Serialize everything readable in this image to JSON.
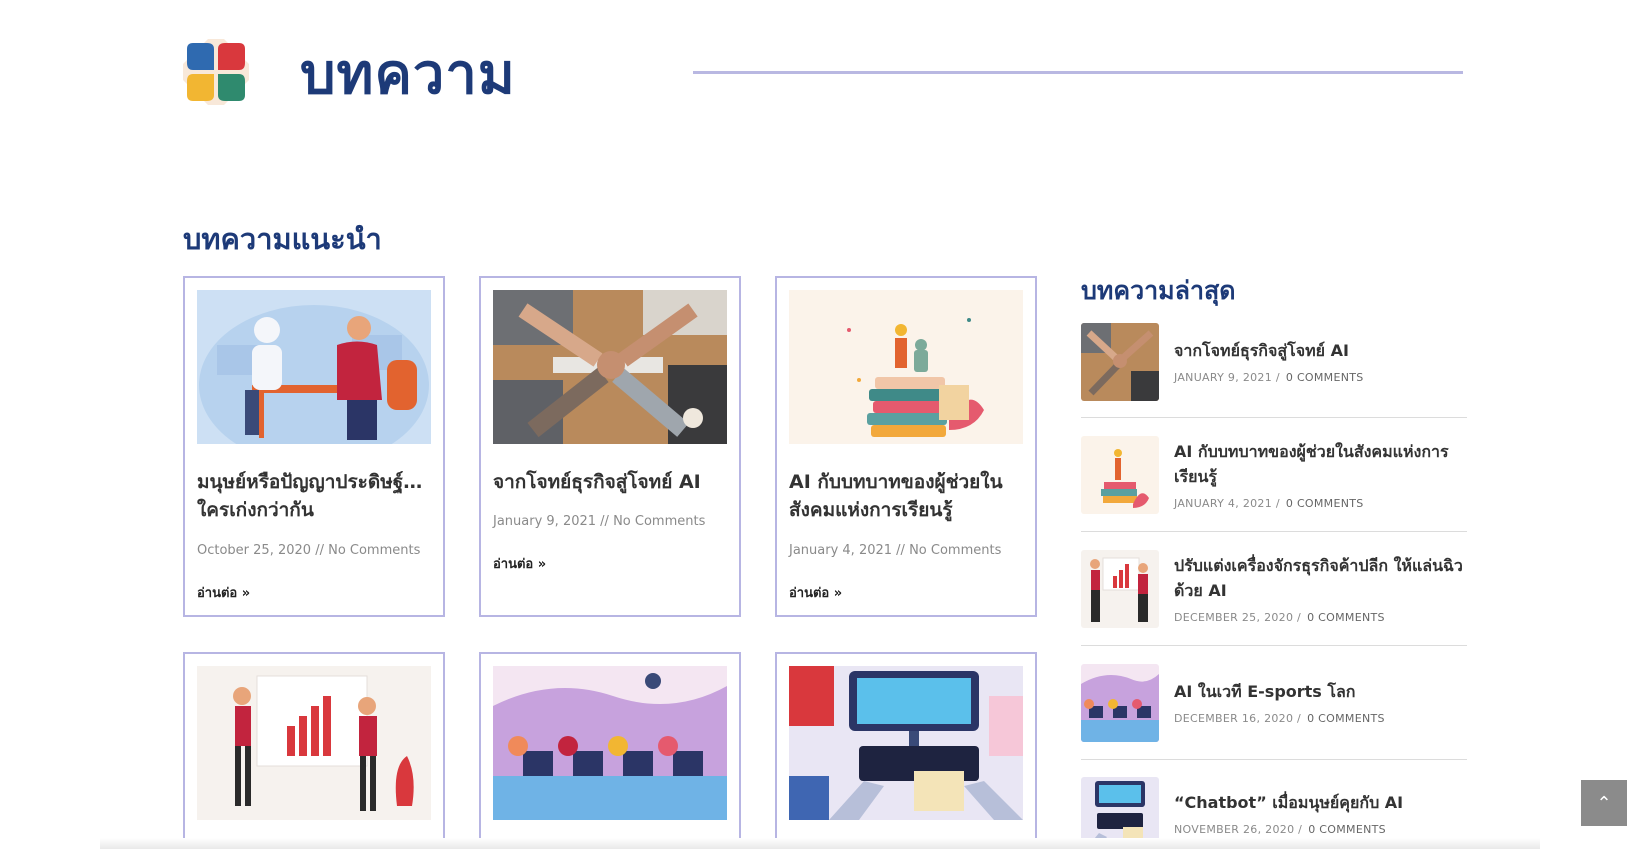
{
  "header": {
    "title": "บทความ",
    "logo_icon": "flower-logo-icon"
  },
  "featured": {
    "heading": "บทความแนะนำ",
    "cards": [
      {
        "title": "มนุษย์หรือปัญญาประดิษฐ์… ใครเก่งกว่ากัน",
        "date": "October 25, 2020",
        "comments": "No Comments",
        "read_more": "อ่านต่อ »"
      },
      {
        "title": "จากโจทย์ธุรกิจสู่โจทย์ AI",
        "date": "January 9, 2021",
        "comments": "No Comments",
        "read_more": "อ่านต่อ »"
      },
      {
        "title": "AI กับบทบาทของผู้ช่วยในสังคมแห่งการเรียนรู้",
        "date": "January 4, 2021",
        "comments": "No Comments",
        "read_more": "อ่านต่อ »"
      }
    ],
    "separator": " // "
  },
  "latest": {
    "heading": "บทความล่าสุด",
    "items": [
      {
        "title": "จากโจทย์ธุรกิจสู่โจทย์ AI",
        "date": "JANUARY 9, 2021",
        "comments": "0 COMMENTS"
      },
      {
        "title": "AI กับบทบาทของผู้ช่วยในสังคมแห่งการเรียนรู้",
        "date": "JANUARY 4, 2021",
        "comments": "0 COMMENTS"
      },
      {
        "title": "ปรับแต่งเครื่องจักรธุรกิจค้าปลีก ให้แล่นฉิวด้วย AI",
        "date": "DECEMBER 25, 2020",
        "comments": "0 COMMENTS"
      },
      {
        "title": "AI ในเวที E-sports โลก",
        "date": "DECEMBER 16, 2020",
        "comments": "0 COMMENTS"
      },
      {
        "title": "“Chatbot” เมื่อมนุษย์คุยกับ AI",
        "date": "NOVEMBER 26, 2020",
        "comments": "0 COMMENTS"
      }
    ],
    "meta_sep": " /"
  },
  "scroll_top": {
    "icon": "chevron-up-icon",
    "glyph": "⌃"
  },
  "colors": {
    "brand_navy": "#1d3a78",
    "card_border": "#b7b5e3",
    "rule": "#b9b8e2"
  }
}
